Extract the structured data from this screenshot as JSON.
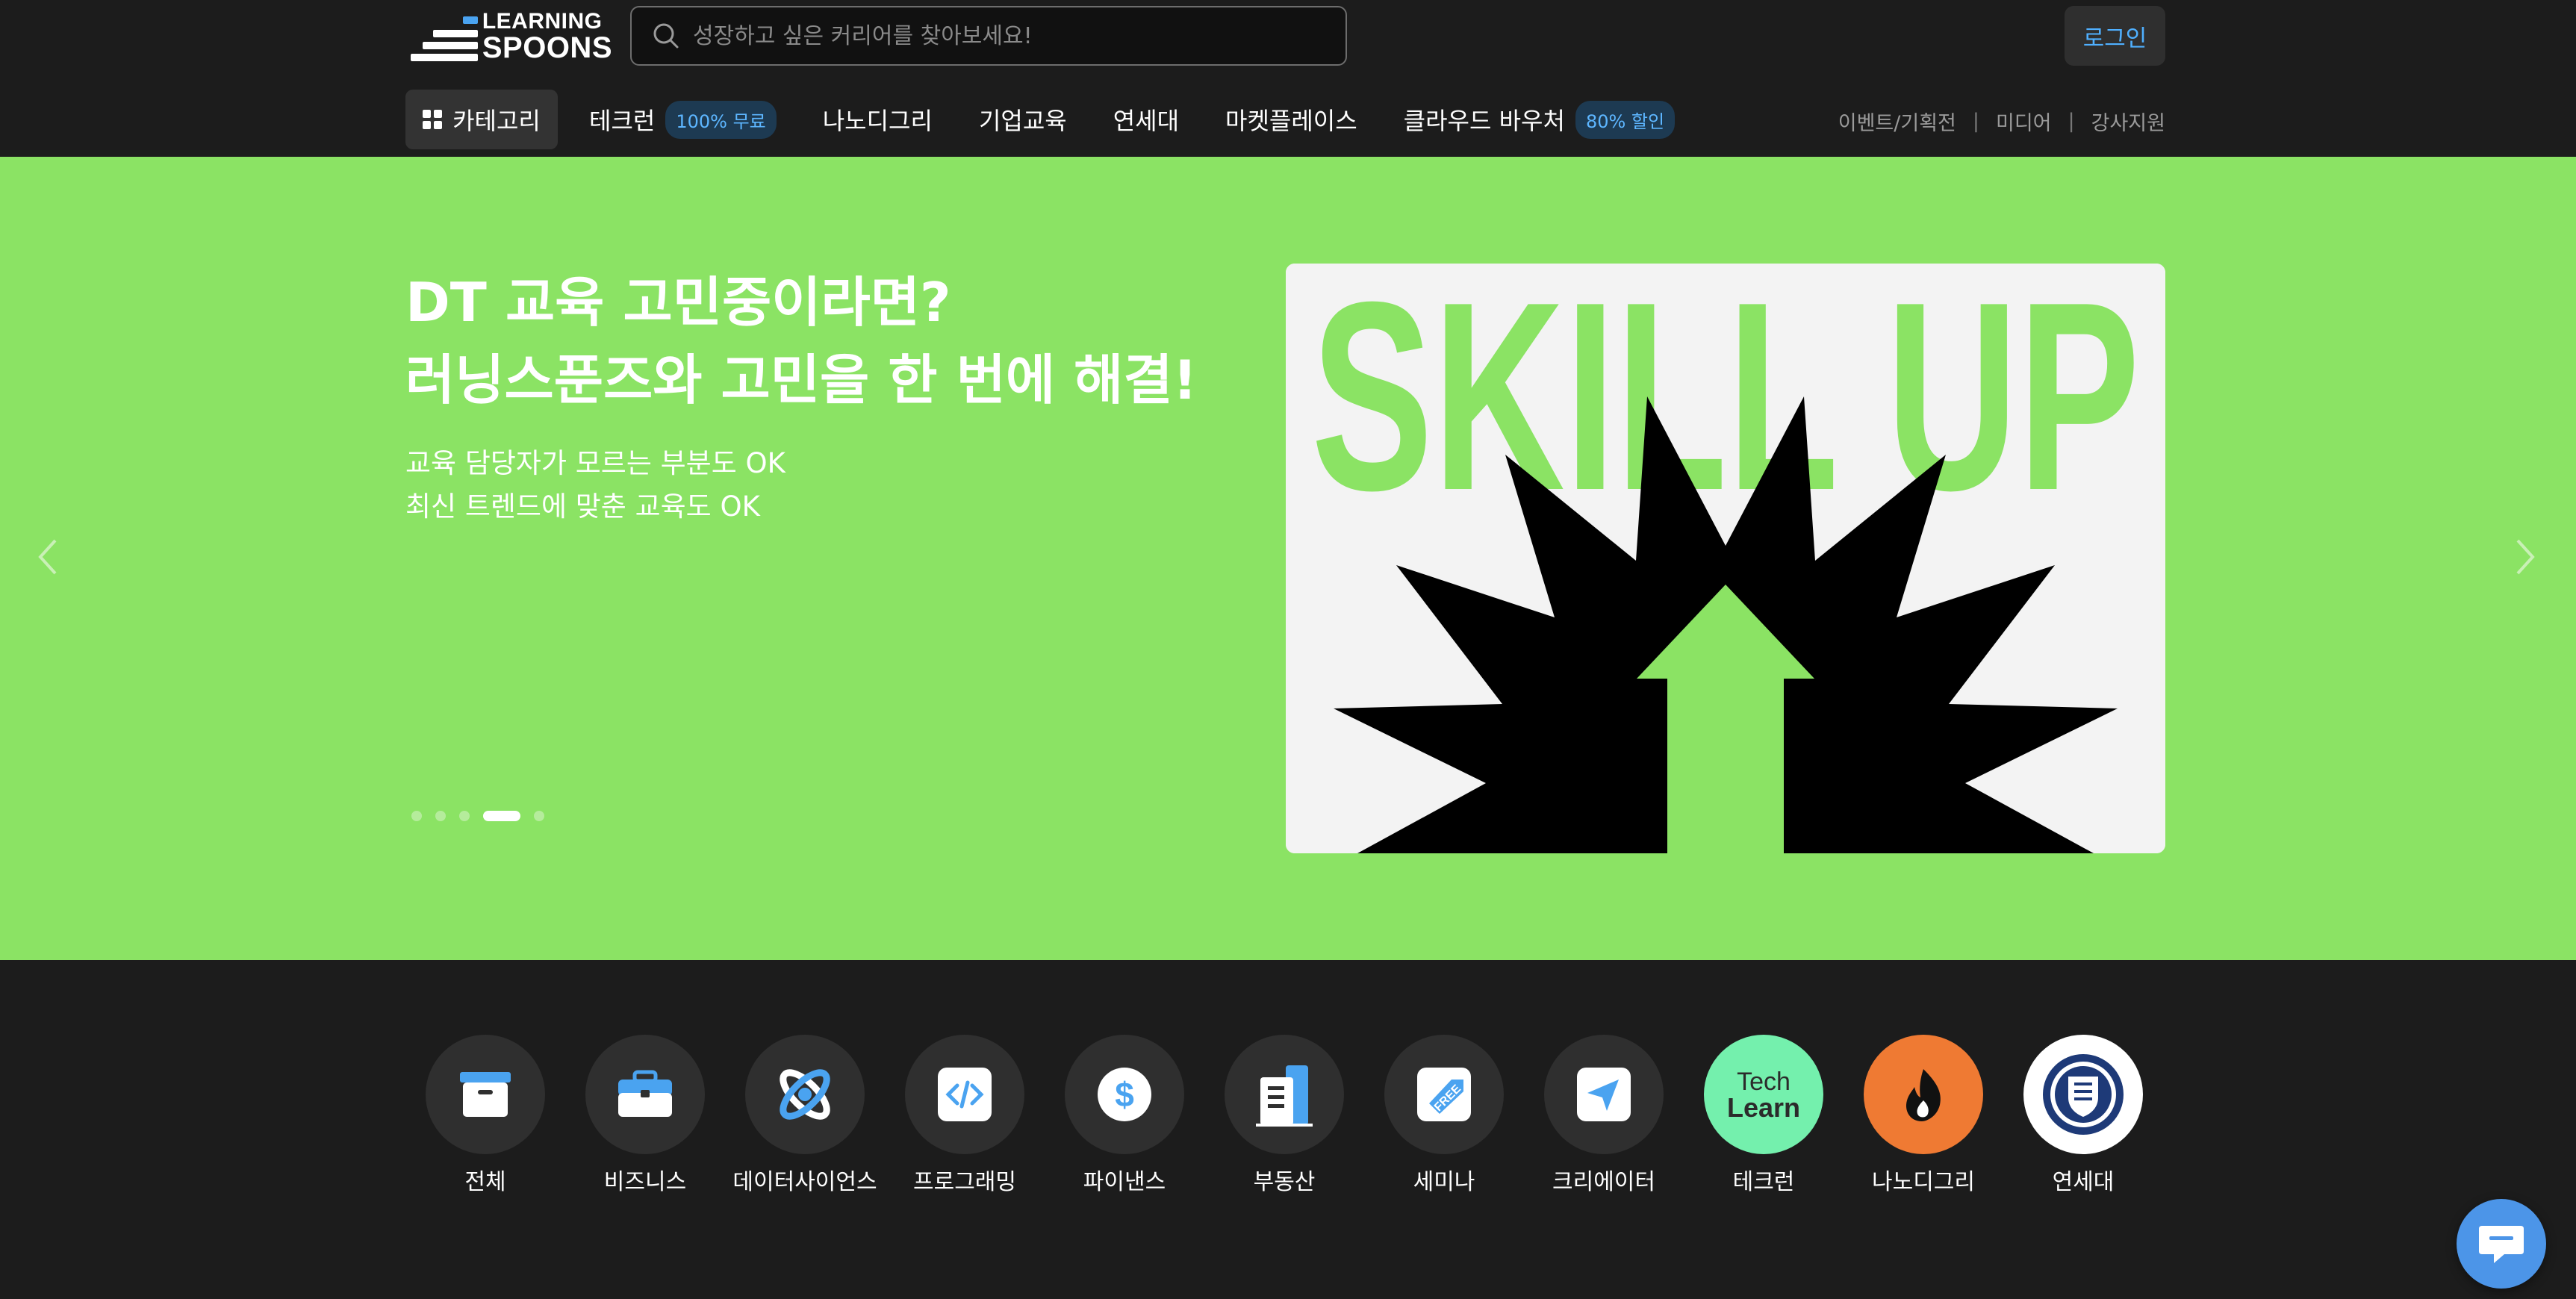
{
  "header": {
    "logo_line1": "LEARNING",
    "logo_line2": "SPOONS",
    "search_placeholder": "성장하고 싶은 커리어를 찾아보세요!",
    "login_label": "로그인"
  },
  "nav": {
    "category_label": "카테고리",
    "items": [
      {
        "label": "테크런",
        "badge": "100% 무료"
      },
      {
        "label": "나노디그리"
      },
      {
        "label": "기업교육"
      },
      {
        "label": "연세대"
      },
      {
        "label": "마켓플레이스"
      },
      {
        "label": "클라우드 바우처",
        "badge": "80% 할인"
      }
    ],
    "util_links": [
      "이벤트/기획전",
      "미디어",
      "강사지원"
    ],
    "util_separator": "|"
  },
  "hero": {
    "title_line1": "DT 교육 고민중이라면?",
    "title_line2": "러닝스푼즈와 고민을 한 번에 해결!",
    "subtitle_line1": "교육 담당자가 모르는 부분도 OK",
    "subtitle_line2": "최신 트렌드에 맞춘 교육도 OK",
    "image_text": "SKILL UP",
    "slide_count": 5,
    "active_slide": 4,
    "colors": {
      "background": "#8be364",
      "accent": "#8be364"
    }
  },
  "categories": [
    {
      "label": "전체",
      "icon": "archive-box-icon"
    },
    {
      "label": "비즈니스",
      "icon": "briefcase-icon"
    },
    {
      "label": "데이터사이언스",
      "icon": "atom-icon"
    },
    {
      "label": "프로그래밍",
      "icon": "code-icon"
    },
    {
      "label": "파이낸스",
      "icon": "dollar-icon"
    },
    {
      "label": "부동산",
      "icon": "building-icon"
    },
    {
      "label": "세미나",
      "icon": "free-tag-icon"
    },
    {
      "label": "크리에이터",
      "icon": "paper-plane-icon"
    },
    {
      "label": "테크런",
      "icon": "techlearn-logo-icon",
      "logo_text1": "Tech",
      "logo_text2": "Learn"
    },
    {
      "label": "나노디그리",
      "icon": "flame-icon"
    },
    {
      "label": "연세대",
      "icon": "yonsei-emblem-icon"
    }
  ]
}
